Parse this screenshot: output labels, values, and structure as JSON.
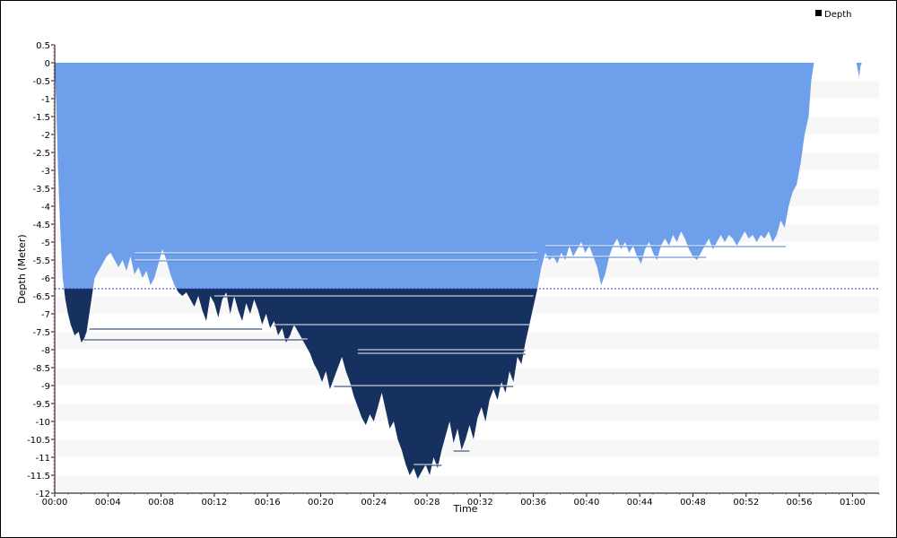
{
  "chart_data": {
    "type": "area",
    "xlabel": "Time",
    "ylabel": "Depth (Meter)",
    "legend": {
      "label": "Depth",
      "placement": "top-right"
    },
    "ylim": [
      -12,
      0.5
    ],
    "xlim_minutes": [
      0,
      62
    ],
    "y_ticks": [
      "0.5",
      "0",
      "-0.5",
      "-1",
      "-1.5",
      "-2",
      "-2.5",
      "-3",
      "-3.5",
      "-4",
      "-4.5",
      "-5",
      "-5.5",
      "-6",
      "-6.5",
      "-7",
      "-7.5",
      "-8",
      "-8.5",
      "-9",
      "-9.5",
      "-10",
      "-10.5",
      "-11",
      "-11.5",
      "-12"
    ],
    "x_ticks": [
      "00:00",
      "00:04",
      "00:08",
      "00:12",
      "00:16",
      "00:20",
      "00:24",
      "00:28",
      "00:32",
      "00:36",
      "00:40",
      "00:44",
      "00:48",
      "00:52",
      "00:56",
      "01:00"
    ],
    "threshold_depth": -6.3,
    "colors": {
      "shallow": "#6e9feb",
      "deep": "#16305f",
      "band": "#f7f7f7",
      "threshold_line": "#3333cc"
    },
    "series": [
      {
        "name": "Depth",
        "points": [
          [
            0.0,
            0.0
          ],
          [
            0.1,
            -1.0
          ],
          [
            0.25,
            -3.0
          ],
          [
            0.4,
            -4.5
          ],
          [
            0.6,
            -6.0
          ],
          [
            0.8,
            -6.6
          ],
          [
            1.0,
            -7.0
          ],
          [
            1.2,
            -7.3
          ],
          [
            1.5,
            -7.6
          ],
          [
            1.8,
            -7.5
          ],
          [
            2.0,
            -7.8
          ],
          [
            2.2,
            -7.7
          ],
          [
            2.4,
            -7.5
          ],
          [
            2.6,
            -7.0
          ],
          [
            2.8,
            -6.5
          ],
          [
            3.0,
            -6.0
          ],
          [
            3.3,
            -5.8
          ],
          [
            3.6,
            -5.6
          ],
          [
            3.9,
            -5.4
          ],
          [
            4.2,
            -5.3
          ],
          [
            4.5,
            -5.5
          ],
          [
            4.8,
            -5.7
          ],
          [
            5.1,
            -5.5
          ],
          [
            5.4,
            -5.8
          ],
          [
            5.7,
            -5.4
          ],
          [
            6.0,
            -5.9
          ],
          [
            6.3,
            -5.7
          ],
          [
            6.6,
            -6.0
          ],
          [
            6.9,
            -5.8
          ],
          [
            7.2,
            -6.2
          ],
          [
            7.5,
            -6.0
          ],
          [
            7.8,
            -5.6
          ],
          [
            8.1,
            -5.2
          ],
          [
            8.4,
            -5.5
          ],
          [
            8.7,
            -5.9
          ],
          [
            9.0,
            -6.2
          ],
          [
            9.3,
            -6.4
          ],
          [
            9.6,
            -6.5
          ],
          [
            9.9,
            -6.4
          ],
          [
            10.2,
            -6.6
          ],
          [
            10.5,
            -6.8
          ],
          [
            10.8,
            -6.5
          ],
          [
            11.1,
            -6.9
          ],
          [
            11.4,
            -7.2
          ],
          [
            11.7,
            -6.5
          ],
          [
            12.0,
            -6.7
          ],
          [
            12.3,
            -7.1
          ],
          [
            12.6,
            -6.6
          ],
          [
            12.9,
            -6.4
          ],
          [
            13.2,
            -7.0
          ],
          [
            13.5,
            -6.5
          ],
          [
            13.8,
            -6.9
          ],
          [
            14.1,
            -7.2
          ],
          [
            14.4,
            -6.7
          ],
          [
            14.7,
            -7.0
          ],
          [
            15.0,
            -6.6
          ],
          [
            15.3,
            -6.9
          ],
          [
            15.6,
            -7.3
          ],
          [
            15.9,
            -7.0
          ],
          [
            16.2,
            -7.4
          ],
          [
            16.5,
            -7.2
          ],
          [
            16.8,
            -7.6
          ],
          [
            17.1,
            -7.4
          ],
          [
            17.4,
            -7.8
          ],
          [
            17.7,
            -7.6
          ],
          [
            18.0,
            -7.3
          ],
          [
            18.3,
            -7.5
          ],
          [
            18.6,
            -7.7
          ],
          [
            18.9,
            -7.9
          ],
          [
            19.2,
            -8.1
          ],
          [
            19.5,
            -8.4
          ],
          [
            19.8,
            -8.6
          ],
          [
            20.1,
            -8.9
          ],
          [
            20.4,
            -8.6
          ],
          [
            20.7,
            -9.1
          ],
          [
            21.0,
            -8.8
          ],
          [
            21.3,
            -8.5
          ],
          [
            21.6,
            -8.2
          ],
          [
            21.9,
            -8.6
          ],
          [
            22.2,
            -8.9
          ],
          [
            22.5,
            -9.3
          ],
          [
            22.8,
            -9.6
          ],
          [
            23.1,
            -9.9
          ],
          [
            23.4,
            -10.1
          ],
          [
            23.7,
            -9.8
          ],
          [
            24.0,
            -10.0
          ],
          [
            24.3,
            -9.6
          ],
          [
            24.6,
            -9.2
          ],
          [
            24.9,
            -9.7
          ],
          [
            25.2,
            -10.2
          ],
          [
            25.5,
            -10.0
          ],
          [
            25.8,
            -10.5
          ],
          [
            26.1,
            -10.8
          ],
          [
            26.4,
            -11.2
          ],
          [
            26.7,
            -11.5
          ],
          [
            27.0,
            -11.3
          ],
          [
            27.3,
            -11.6
          ],
          [
            27.6,
            -11.4
          ],
          [
            27.9,
            -11.2
          ],
          [
            28.2,
            -11.5
          ],
          [
            28.5,
            -11.0
          ],
          [
            28.8,
            -11.3
          ],
          [
            29.1,
            -10.8
          ],
          [
            29.4,
            -10.4
          ],
          [
            29.7,
            -10.0
          ],
          [
            30.0,
            -10.6
          ],
          [
            30.3,
            -10.2
          ],
          [
            30.6,
            -10.8
          ],
          [
            30.9,
            -10.5
          ],
          [
            31.2,
            -10.1
          ],
          [
            31.5,
            -10.5
          ],
          [
            31.8,
            -9.9
          ],
          [
            32.1,
            -9.6
          ],
          [
            32.4,
            -10.0
          ],
          [
            32.7,
            -9.4
          ],
          [
            33.0,
            -9.1
          ],
          [
            33.3,
            -9.4
          ],
          [
            33.6,
            -8.9
          ],
          [
            33.9,
            -9.2
          ],
          [
            34.2,
            -8.6
          ],
          [
            34.5,
            -8.9
          ],
          [
            34.8,
            -8.2
          ],
          [
            35.1,
            -8.4
          ],
          [
            35.4,
            -7.8
          ],
          [
            35.7,
            -7.3
          ],
          [
            36.0,
            -6.8
          ],
          [
            36.3,
            -6.3
          ],
          [
            36.6,
            -5.7
          ],
          [
            36.9,
            -5.3
          ],
          [
            37.2,
            -5.5
          ],
          [
            37.5,
            -5.4
          ],
          [
            37.8,
            -5.6
          ],
          [
            38.1,
            -5.3
          ],
          [
            38.4,
            -5.5
          ],
          [
            38.7,
            -5.1
          ],
          [
            39.0,
            -5.4
          ],
          [
            39.3,
            -5.2
          ],
          [
            39.6,
            -5.0
          ],
          [
            39.9,
            -5.3
          ],
          [
            40.2,
            -5.1
          ],
          [
            40.5,
            -5.4
          ],
          [
            40.8,
            -5.7
          ],
          [
            41.1,
            -6.2
          ],
          [
            41.4,
            -5.9
          ],
          [
            41.7,
            -5.4
          ],
          [
            42.0,
            -5.1
          ],
          [
            42.3,
            -4.9
          ],
          [
            42.6,
            -5.2
          ],
          [
            42.9,
            -5.0
          ],
          [
            43.2,
            -5.3
          ],
          [
            43.5,
            -5.1
          ],
          [
            43.8,
            -5.4
          ],
          [
            44.1,
            -5.6
          ],
          [
            44.4,
            -5.2
          ],
          [
            44.7,
            -5.0
          ],
          [
            45.0,
            -5.3
          ],
          [
            45.3,
            -5.5
          ],
          [
            45.6,
            -5.1
          ],
          [
            45.9,
            -4.9
          ],
          [
            46.2,
            -5.1
          ],
          [
            46.5,
            -4.8
          ],
          [
            46.8,
            -5.0
          ],
          [
            47.1,
            -4.7
          ],
          [
            47.4,
            -4.9
          ],
          [
            47.7,
            -5.2
          ],
          [
            48.0,
            -5.4
          ],
          [
            48.3,
            -5.5
          ],
          [
            48.6,
            -5.3
          ],
          [
            48.9,
            -5.1
          ],
          [
            49.2,
            -4.9
          ],
          [
            49.5,
            -5.2
          ],
          [
            49.8,
            -5.0
          ],
          [
            50.1,
            -4.8
          ],
          [
            50.4,
            -5.0
          ],
          [
            50.7,
            -4.8
          ],
          [
            51.0,
            -4.9
          ],
          [
            51.3,
            -5.1
          ],
          [
            51.6,
            -4.9
          ],
          [
            51.9,
            -4.7
          ],
          [
            52.2,
            -4.9
          ],
          [
            52.5,
            -4.8
          ],
          [
            52.8,
            -5.0
          ],
          [
            53.1,
            -4.8
          ],
          [
            53.4,
            -4.9
          ],
          [
            53.7,
            -4.7
          ],
          [
            54.0,
            -5.0
          ],
          [
            54.3,
            -4.8
          ],
          [
            54.6,
            -4.4
          ],
          [
            54.9,
            -4.6
          ],
          [
            55.2,
            -4.0
          ],
          [
            55.5,
            -3.6
          ],
          [
            55.8,
            -3.4
          ],
          [
            56.1,
            -2.8
          ],
          [
            56.4,
            -2.0
          ],
          [
            56.7,
            -1.5
          ],
          [
            56.9,
            -0.5
          ],
          [
            57.1,
            0.0
          ],
          [
            60.3,
            0.0
          ],
          [
            60.4,
            -0.2
          ],
          [
            60.5,
            -0.4
          ],
          [
            60.6,
            -0.1
          ],
          [
            60.7,
            0.0
          ]
        ]
      }
    ],
    "ceiling_steps": [
      {
        "from": 6.0,
        "to": 36.3,
        "depth": -5.3
      },
      {
        "from": 6.0,
        "to": 36.3,
        "depth": -5.5
      },
      {
        "from": 2.6,
        "to": 15.6,
        "depth": -7.4
      },
      {
        "from": 2.2,
        "to": 19.0,
        "depth": -7.7
      },
      {
        "from": 12.0,
        "to": 36.0,
        "depth": -6.5
      },
      {
        "from": 16.5,
        "to": 35.7,
        "depth": -7.3
      },
      {
        "from": 22.8,
        "to": 35.4,
        "depth": -8.0
      },
      {
        "from": 22.8,
        "to": 35.4,
        "depth": -8.1
      },
      {
        "from": 21.0,
        "to": 34.5,
        "depth": -9.0
      },
      {
        "from": 27.0,
        "to": 29.1,
        "depth": -11.2
      },
      {
        "from": 30.0,
        "to": 31.2,
        "depth": -10.8
      },
      {
        "from": 36.9,
        "to": 55.0,
        "depth": -5.1
      },
      {
        "from": 36.9,
        "to": 49.0,
        "depth": -5.4
      }
    ]
  }
}
